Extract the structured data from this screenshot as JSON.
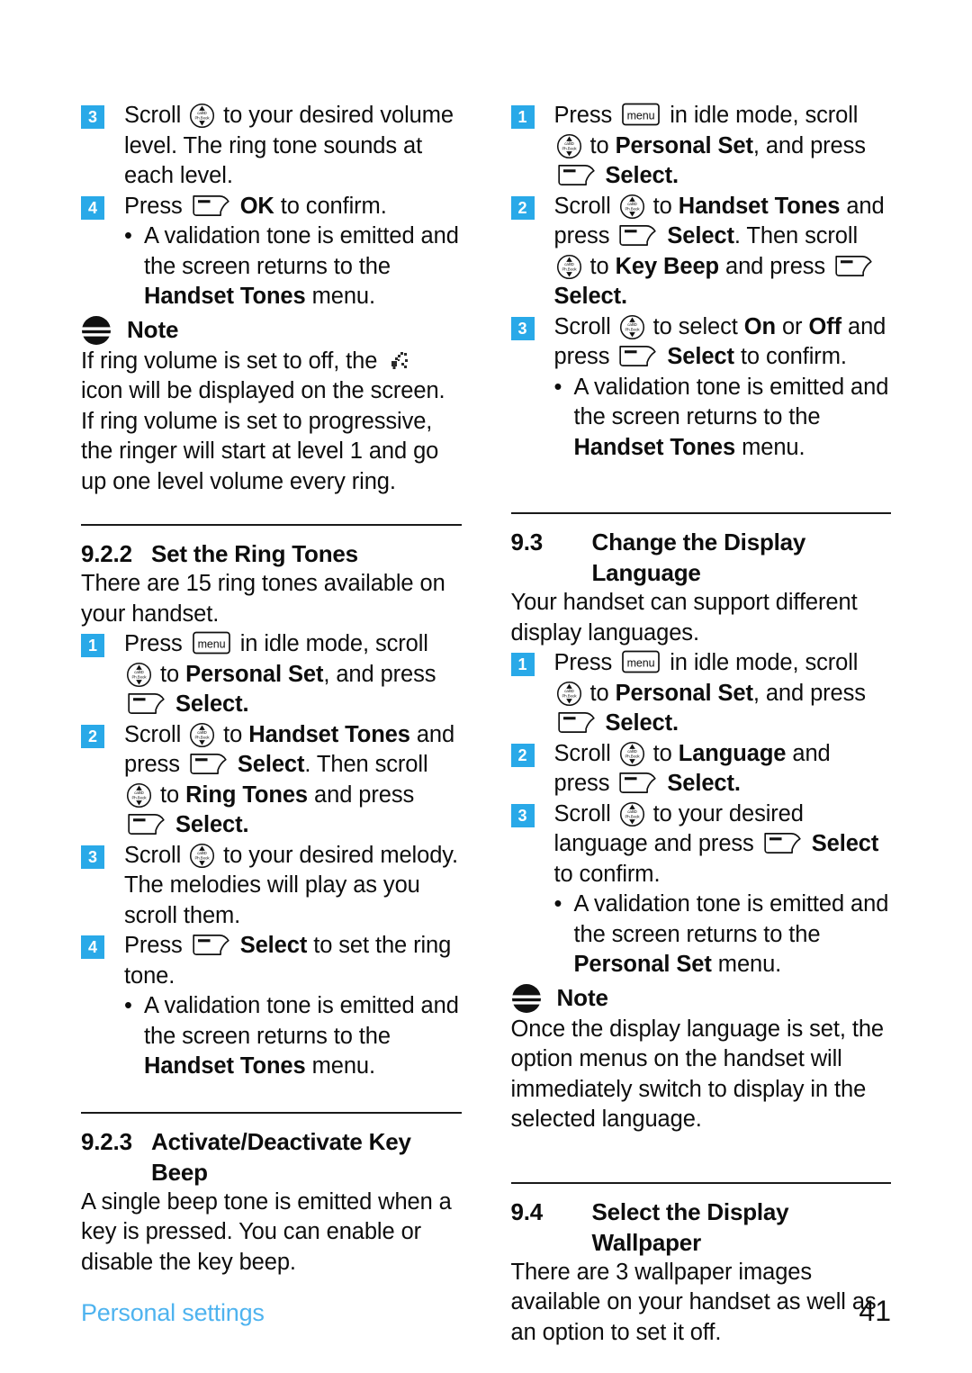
{
  "footer": {
    "chapter": "Personal settings",
    "page_number": "41",
    "chapter_color": "#4eb3ef"
  },
  "theme": {
    "step_badge_color": "#29a9e8",
    "text_color": "#0d0d0d"
  },
  "icons": {
    "nav_key": "navigation-scroll-key-icon",
    "soft_key": "soft-key-icon",
    "menu_key": "menu-key-icon",
    "ringer_off": "ringer-off-icon",
    "note": "note-icon"
  },
  "left_column": {
    "step3_volume": {
      "number": "3",
      "t1": "Scroll",
      "t2": "to your desired volume level. The ring tone sounds at each level."
    },
    "step4_ok": {
      "number": "4",
      "t1": "Press",
      "t2": "OK",
      "t3": "to confirm."
    },
    "bullet_validation": {
      "dot": "•",
      "t1": "A validation tone is emitted and the screen returns to the",
      "t2": "Handset Tones",
      "t3": "menu."
    },
    "note": {
      "title": "Note",
      "p1_a": "If ring volume is set to off, the",
      "p1_b": "icon will be displayed on the screen.",
      "p2": "If ring volume is set to progressive, the ringer will start at level 1 and go up one level volume every ring."
    },
    "section_922": {
      "number": "9.2.2",
      "title": "Set the Ring Tones",
      "intro": "There are 15 ring tones available on your handset.",
      "step1": {
        "number": "1",
        "t1": "Press",
        "t2": "in idle mode, scroll",
        "t3": "to",
        "t4": "Personal Set",
        "t5": ", and press",
        "t6": "Select",
        "t7": "."
      },
      "step2": {
        "number": "2",
        "t1": "Scroll",
        "t2": "to",
        "t3": "Handset Tones",
        "t4": "and press",
        "t5": "Select",
        "t6": ". Then scroll",
        "t7": "to",
        "t8": "Ring Tones",
        "t9": "and press",
        "t10": "Select",
        "t11": "."
      },
      "step3": {
        "number": "3",
        "t1": "Scroll",
        "t2": "to your desired melody. The melodies will play as you scroll them."
      },
      "step4": {
        "number": "4",
        "t1": "Press",
        "t2": "Select",
        "t3": "to set the ring tone."
      },
      "bullet": {
        "dot": "•",
        "t1": "A validation tone is emitted and the screen returns to the",
        "t2": "Handset Tones",
        "t3": "menu."
      }
    },
    "section_923": {
      "number": "9.2.3",
      "title_line1": "Activate/Deactivate Key",
      "title_line2": "Beep",
      "body": "A single beep tone is emitted when a key is pressed. You can enable or disable the key beep."
    }
  },
  "right_column": {
    "keybeep_steps": {
      "step1": {
        "number": "1",
        "t1": "Press",
        "t2": "in idle mode, scroll",
        "t3": "to",
        "t4": "Personal Set",
        "t5": ", and press",
        "t6": "Select",
        "t7": "."
      },
      "step2": {
        "number": "2",
        "t1": "Scroll",
        "t2": "to",
        "t3": "Handset Tones",
        "t4": "and press",
        "t5": "Select",
        "t6": ". Then scroll",
        "t7": "to",
        "t8": "Key Beep",
        "t9": "and press",
        "t10": "Select",
        "t11": "."
      },
      "step3": {
        "number": "3",
        "t1": "Scroll",
        "t2": "to select",
        "t3": "On",
        "t4": "or",
        "t5": "Off",
        "t6": "and press",
        "t7": "Select",
        "t8": "to confirm."
      },
      "bullet": {
        "dot": "•",
        "t1": "A validation tone is emitted and the screen returns to the",
        "t2": "Handset Tones",
        "t3": "menu."
      }
    },
    "section_93": {
      "number": "9.3",
      "title": "Change the Display Language",
      "intro": "Your handset can support different display languages.",
      "step1": {
        "number": "1",
        "t1": "Press",
        "t2": "in idle mode, scroll",
        "t3": "to",
        "t4": "Personal Set",
        "t5": ", and press",
        "t6": "Select",
        "t7": "."
      },
      "step2": {
        "number": "2",
        "t1": "Scroll",
        "t2": "to",
        "t3": "Language",
        "t4": "and press",
        "t5": "Select",
        "t6": "."
      },
      "step3": {
        "number": "3",
        "t1": "Scroll",
        "t2": "to your desired language and press",
        "t3": "Select",
        "t4": "to confirm."
      },
      "bullet": {
        "dot": "•",
        "t1": "A validation tone is emitted and the screen returns to the",
        "t2": "Personal Set",
        "t3": "menu."
      },
      "note": {
        "title": "Note",
        "body": "Once the display language is set, the option menus on the handset will immediately switch to display in the selected language."
      }
    },
    "section_94": {
      "number": "9.4",
      "title": "Select the Display Wallpaper",
      "body": "There are 3 wallpaper images available on your handset as well as an option to set it off."
    }
  }
}
